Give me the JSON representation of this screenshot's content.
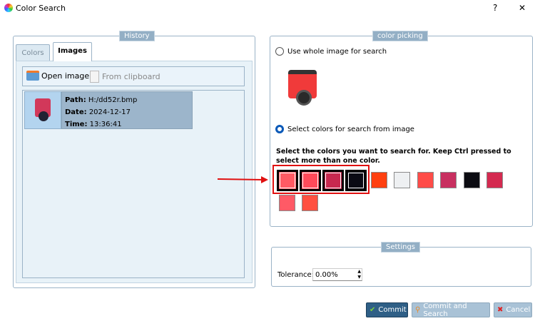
{
  "window": {
    "title": "Color Search",
    "help": "?",
    "close": "✕"
  },
  "history": {
    "label": "History",
    "tabs": [
      {
        "label": "Colors"
      },
      {
        "label": "Images"
      }
    ],
    "toolbar": {
      "open": "Open image",
      "clipboard": "From clipboard"
    },
    "items": [
      {
        "path_label": "Path:",
        "path": "H:/dd52r.bmp",
        "date_label": "Date:",
        "date": "2024-12-17",
        "time_label": "Time:",
        "time": "13:36:41"
      }
    ]
  },
  "picking": {
    "label": "color picking",
    "radio_whole": "Use whole image for search",
    "radio_select": "Select colors for search from image",
    "selected_option": "select",
    "instruction": "Select the colors you want to search for. Keep Ctrl pressed to select more than one color.",
    "swatches": [
      {
        "color": "#ff5a64",
        "selected": true
      },
      {
        "color": "#ff4a5a",
        "selected": true
      },
      {
        "color": "#c8284f",
        "selected": true
      },
      {
        "color": "#0a0a14",
        "selected": true
      },
      {
        "color": "#ff4010",
        "selected": false
      },
      {
        "color": "#eef0f2",
        "selected": false
      },
      {
        "color": "#ff4c48",
        "selected": false
      },
      {
        "color": "#c83060",
        "selected": false
      },
      {
        "color": "#0c0c12",
        "selected": false
      },
      {
        "color": "#d42a50",
        "selected": false
      },
      {
        "color": "#ff5a66",
        "selected": false
      },
      {
        "color": "#ff5040",
        "selected": false
      }
    ],
    "highlight_color": "#e01010"
  },
  "settings": {
    "label": "Settings",
    "tolerance_label": "Tolerance:",
    "tolerance": "0.00%"
  },
  "buttons": {
    "commit": "Commit",
    "commit_search": "Commit and Search",
    "cancel": "Cancel"
  }
}
